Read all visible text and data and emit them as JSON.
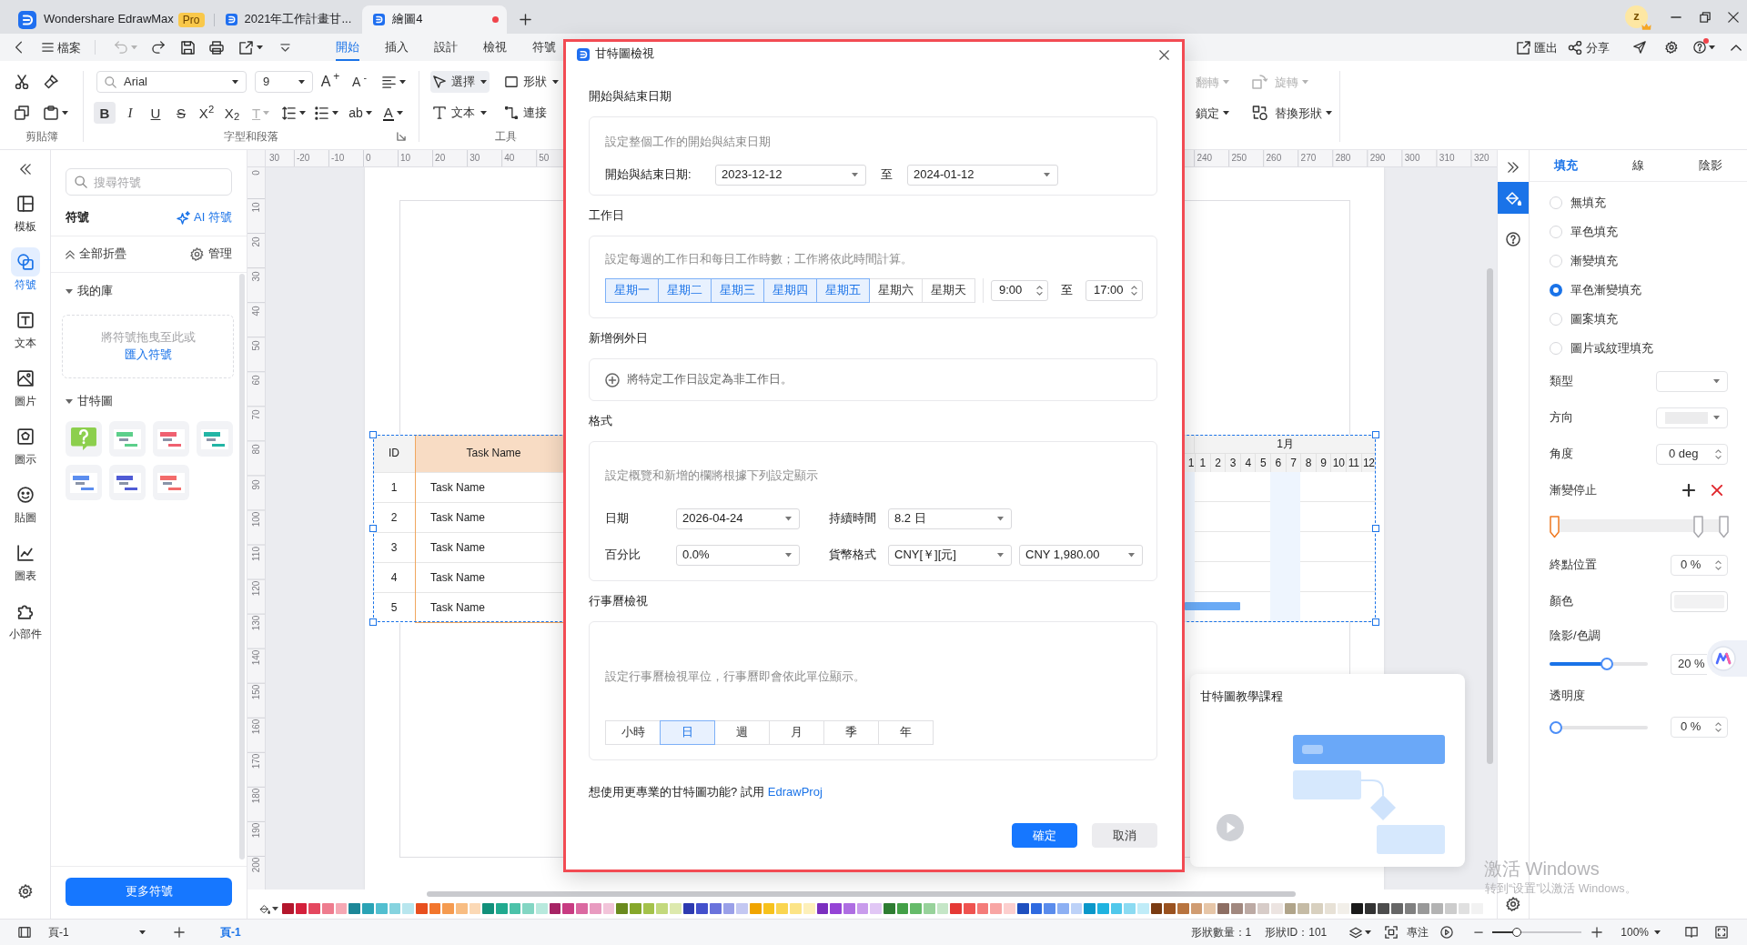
{
  "title_bar": {
    "tabs": [
      {
        "kind": "app",
        "label": "Wondershare EdrawMax",
        "badge": "Pro",
        "selected": false,
        "unsaved": false
      },
      {
        "kind": "document",
        "label": "2021年工作計畫甘...",
        "selected": false,
        "unsaved": false
      },
      {
        "kind": "document",
        "label": "繪圖4",
        "selected": true,
        "unsaved": true
      }
    ],
    "avatar": "z"
  },
  "menu_bar": {
    "file_label": "檔案",
    "undo": {
      "disabled": true
    },
    "tabs": [
      {
        "label": "開始",
        "selected": true
      },
      {
        "label": "插入",
        "selected": false
      },
      {
        "label": "設計",
        "selected": false
      },
      {
        "label": "檢視",
        "selected": false
      },
      {
        "label": "符號",
        "selected": false
      }
    ],
    "actions": [
      {
        "kind": "export",
        "label": "匯出"
      },
      {
        "kind": "share",
        "label": "分享"
      }
    ],
    "help": {
      "notification": true
    }
  },
  "ribbon": {
    "groups": [
      {
        "label": "剪貼簿",
        "launcher": false
      },
      {
        "label": "字型和段落",
        "launcher": true
      },
      {
        "label": "工具",
        "launcher": false
      }
    ],
    "font": {
      "value": "Arial"
    },
    "font_size": {
      "value": "9"
    },
    "font_buttons": [
      {
        "kind": "grow",
        "glyph": "A$^{+}$"
      },
      {
        "kind": "shrink",
        "glyph": "A$^{-}$"
      }
    ],
    "format_buttons": [
      {
        "kind": "bold",
        "glyph": "B",
        "on": true,
        "disabled": false
      },
      {
        "kind": "italic",
        "glyph": "I",
        "on": false,
        "disabled": false
      },
      {
        "kind": "underline",
        "glyph": "U",
        "on": false,
        "disabled": false
      },
      {
        "kind": "strike",
        "glyph": "S",
        "on": false,
        "disabled": false
      },
      {
        "kind": "superscript",
        "glyph": "X$^{2}$",
        "on": false,
        "disabled": false
      },
      {
        "kind": "subscript",
        "glyph": "X$_{2}$",
        "on": false,
        "disabled": false
      },
      {
        "kind": "clear",
        "glyph": "T",
        "on": false,
        "disabled": true
      },
      {
        "kind": "highlight",
        "glyph": "ab",
        "on": false,
        "disabled": false
      },
      {
        "kind": "color",
        "glyph": "A",
        "on": false,
        "disabled": false
      }
    ],
    "tools": [
      {
        "kind": "select",
        "label": "選擇",
        "selected": true
      },
      {
        "kind": "shape",
        "label": "形狀",
        "selected": false
      },
      {
        "kind": "text",
        "label": "文本",
        "selected": false
      },
      {
        "kind": "connector",
        "label": "連接",
        "selected": false
      }
    ],
    "arrange": [
      {
        "kind": "flip",
        "label": "翻轉",
        "disabled": true
      },
      {
        "kind": "rotate",
        "label": "旋轉",
        "disabled": true
      },
      {
        "kind": "lock",
        "label": "鎖定",
        "disabled": false
      },
      {
        "kind": "replace",
        "label": "替換形狀",
        "disabled": false
      }
    ]
  },
  "side_rail": {
    "items": [
      {
        "kind": "templates",
        "label": "模板",
        "selected": false
      },
      {
        "kind": "symbols",
        "label": "符號",
        "selected": true
      },
      {
        "kind": "text",
        "label": "文本",
        "selected": false
      },
      {
        "kind": "images",
        "label": "圖片",
        "selected": false
      },
      {
        "kind": "icons",
        "label": "圖示",
        "selected": false
      },
      {
        "kind": "stickers",
        "label": "貼圖",
        "selected": false
      },
      {
        "kind": "charts",
        "label": "圖表",
        "selected": false
      },
      {
        "kind": "widgets",
        "label": "小部件",
        "selected": false
      }
    ]
  },
  "library": {
    "search": {
      "placeholder": "搜尋符號"
    },
    "title": "符號",
    "ai_link": "AI 符號",
    "collapse_all": "全部折疊",
    "manage": "管理",
    "my_library": {
      "label": "我的庫",
      "expanded": true,
      "drop_hint": "將符號拖曳至此或",
      "import_link": "匯入符號"
    },
    "gantt": {
      "label": "甘特圖",
      "expanded": true,
      "thumbnails": [
        {
          "kind": "help"
        },
        {
          "kind": "gantt",
          "color": "#5ccf8a"
        },
        {
          "kind": "gantt",
          "color": "#f06070"
        },
        {
          "kind": "gantt",
          "color": "#22b5a5"
        },
        {
          "kind": "gantt",
          "color": "#5b8def"
        },
        {
          "kind": "gantt",
          "color": "#4f5bd5"
        },
        {
          "kind": "gantt",
          "color": "#f36b6b"
        }
      ]
    },
    "more_button": "更多符號"
  },
  "canvas": {
    "top_ruler": {
      "left_labels": [
        "30",
        "-20",
        "-10",
        "0",
        "10",
        "20",
        "30",
        "40",
        "50"
      ],
      "right_labels": [
        "240",
        "250",
        "260",
        "270",
        "280",
        "290",
        "300",
        "310",
        "320"
      ]
    },
    "left_ruler": [
      "0",
      "10",
      "20",
      "30",
      "40",
      "50",
      "60",
      "70",
      "80",
      "90",
      "100",
      "110",
      "120",
      "130",
      "140",
      "150",
      "160",
      "170",
      "180",
      "190",
      "200"
    ],
    "gantt": {
      "selected": true,
      "columns": [
        "ID",
        "Task Name"
      ],
      "rows": [
        {
          "id": "1",
          "task": "Task Name",
          "bar": false
        },
        {
          "id": "2",
          "task": "Task Name",
          "bar": false
        },
        {
          "id": "3",
          "task": "Task Name",
          "bar": false
        },
        {
          "id": "4",
          "task": "Task Name",
          "bar": false
        },
        {
          "id": "5",
          "task": "Task Name",
          "bar": true
        }
      ],
      "month": "1月",
      "days": [
        {
          "label": "1",
          "weekend": true
        },
        {
          "label": "1",
          "weekend": false
        },
        {
          "label": "2",
          "weekend": false
        },
        {
          "label": "3",
          "weekend": false
        },
        {
          "label": "4",
          "weekend": false
        },
        {
          "label": "5",
          "weekend": false
        },
        {
          "label": "6",
          "weekend": true
        },
        {
          "label": "7",
          "weekend": true
        },
        {
          "label": "8",
          "weekend": false
        },
        {
          "label": "9",
          "weekend": false
        },
        {
          "label": "10",
          "weekend": false
        },
        {
          "label": "11",
          "weekend": false
        },
        {
          "label": "12",
          "weekend": false
        }
      ]
    }
  },
  "dialog": {
    "highlighted": true,
    "title": "甘特圖檢視",
    "date_range": {
      "heading": "開始與結束日期",
      "hint": "設定整個工作的開始與結束日期",
      "label": "開始與結束日期:",
      "start": "2023-12-12",
      "separator": "至",
      "end": "2024-01-12"
    },
    "workdays": {
      "heading": "工作日",
      "hint": "設定每週的工作日和每日工作時數；工作將依此時間計算。",
      "days": [
        {
          "label": "星期一",
          "selected": true
        },
        {
          "label": "星期二",
          "selected": true
        },
        {
          "label": "星期三",
          "selected": true
        },
        {
          "label": "星期四",
          "selected": true
        },
        {
          "label": "星期五",
          "selected": true
        },
        {
          "label": "星期六",
          "selected": false
        },
        {
          "label": "星期天",
          "selected": false
        }
      ],
      "start_time": "9:00",
      "separator": "至",
      "end_time": "17:00"
    },
    "exceptions": {
      "heading": "新增例外日",
      "action": "將特定工作日設定為非工作日。"
    },
    "format": {
      "heading": "格式",
      "hint": "設定概覽和新增的欄將根據下列設定顯示",
      "fields": [
        {
          "label": "日期",
          "values": [
            "2026-04-24"
          ]
        },
        {
          "label": "持續時間",
          "values": [
            "8.2 日"
          ]
        },
        {
          "label": "百分比",
          "values": [
            "0.0%"
          ]
        },
        {
          "label": "貨幣格式",
          "values": [
            "CNY[￥][元]",
            "CNY 1,980.00"
          ]
        }
      ]
    },
    "calendar_view": {
      "heading": "行事曆檢視",
      "hint": "設定行事曆檢視單位，行事曆即會依此單位顯示。",
      "units": [
        {
          "label": "小時",
          "selected": false
        },
        {
          "label": "日",
          "selected": true
        },
        {
          "label": "週",
          "selected": false
        },
        {
          "label": "月",
          "selected": false
        },
        {
          "label": "季",
          "selected": false
        },
        {
          "label": "年",
          "selected": false
        }
      ]
    },
    "footer_text": "想使用更專業的甘特圖功能? 試用",
    "footer_link": "EdrawProj",
    "buttons": [
      {
        "kind": "primary",
        "label": "確定"
      },
      {
        "kind": "secondary",
        "label": "取消"
      }
    ]
  },
  "tutorial": {
    "title": "甘特圖教學課程"
  },
  "right_panel": {
    "strip_tabs": [
      {
        "kind": "fill",
        "selected": true
      }
    ],
    "tabs": [
      {
        "label": "填充",
        "selected": true
      },
      {
        "label": "線",
        "selected": false
      },
      {
        "label": "陰影",
        "selected": false
      }
    ],
    "fill_options": [
      {
        "label": "無填充",
        "selected": false
      },
      {
        "label": "單色填充",
        "selected": false
      },
      {
        "label": "漸變填充",
        "selected": false
      },
      {
        "label": "單色漸變填充",
        "selected": true
      },
      {
        "label": "圖案填充",
        "selected": false
      },
      {
        "label": "圖片或紋理填充",
        "selected": false
      }
    ],
    "type": {
      "label": "類型"
    },
    "direction": {
      "label": "方向"
    },
    "angle": {
      "label": "角度",
      "value": "0 deg"
    },
    "gradient_stops": {
      "label": "漸變停止",
      "stops": [
        {
          "selected": true
        },
        {
          "selected": false
        },
        {
          "selected": false
        }
      ]
    },
    "end_position": {
      "label": "終點位置",
      "value": "0 %"
    },
    "color": {
      "label": "顏色"
    },
    "shade": {
      "label": "陰影/色調",
      "level": 0.6,
      "value": "20 %"
    },
    "transparency": {
      "label": "透明度",
      "level": 0,
      "value": "0 %"
    }
  },
  "palette": [
    {
      "color": "#b3162c"
    },
    {
      "color": "#d4203b"
    },
    {
      "color": "#e4485f"
    },
    {
      "color": "#ee7c8e"
    },
    {
      "color": "#f5a8b4"
    },
    {
      "color": "#1d8798"
    },
    {
      "color": "#2aa3b5"
    },
    {
      "color": "#52bfd0"
    },
    {
      "color": "#86d3df"
    },
    {
      "color": "#b8e6ee"
    },
    {
      "color": "#e84f1e"
    },
    {
      "color": "#f2762d"
    },
    {
      "color": "#f59b50"
    },
    {
      "color": "#f8bd83"
    },
    {
      "color": "#fbd9b6"
    },
    {
      "color": "#12907a"
    },
    {
      "color": "#21aa8f"
    },
    {
      "color": "#4cc2a9"
    },
    {
      "color": "#83d6c3"
    },
    {
      "color": "#b8e9dd"
    },
    {
      "color": "#a62465"
    },
    {
      "color": "#c83b82"
    },
    {
      "color": "#db69a1"
    },
    {
      "color": "#e89bc0"
    },
    {
      "color": "#f2c5da"
    },
    {
      "color": "#6a8a1e"
    },
    {
      "color": "#86a72b"
    },
    {
      "color": "#a4c24b"
    },
    {
      "color": "#c3d97d"
    },
    {
      "color": "#dde9ae"
    },
    {
      "color": "#2d3ab0"
    },
    {
      "color": "#4350cc"
    },
    {
      "color": "#6a73dc"
    },
    {
      "color": "#9aa0e8"
    },
    {
      "color": "#c4c8f2"
    },
    {
      "color": "#f0a400"
    },
    {
      "color": "#f7c21d"
    },
    {
      "color": "#fad550"
    },
    {
      "color": "#fce487"
    },
    {
      "color": "#fdf0ba"
    },
    {
      "color": "#7b2fbf"
    },
    {
      "color": "#9544d6"
    },
    {
      "color": "#ae6ee2"
    },
    {
      "color": "#c99cec"
    },
    {
      "color": "#e1c7f5"
    },
    {
      "color": "#2e7d32"
    },
    {
      "color": "#43a047"
    },
    {
      "color": "#66bb6a"
    },
    {
      "color": "#98d29b"
    },
    {
      "color": "#c5e6c7"
    },
    {
      "color": "#e53935"
    },
    {
      "color": "#ef5350"
    },
    {
      "color": "#f47c7a"
    },
    {
      "color": "#f8a6a4"
    },
    {
      "color": "#fccfce"
    },
    {
      "color": "#1e4fbf"
    },
    {
      "color": "#2f6ae0"
    },
    {
      "color": "#5a8cec"
    },
    {
      "color": "#8db0f3"
    },
    {
      "color": "#bdd2f8"
    },
    {
      "color": "#0a97c9"
    },
    {
      "color": "#1fb3e0"
    },
    {
      "color": "#51c8eb"
    },
    {
      "color": "#8cdbf2"
    },
    {
      "color": "#c0ecf8"
    },
    {
      "color": "#7a3b12"
    },
    {
      "color": "#9a5220"
    },
    {
      "color": "#b8743f"
    },
    {
      "color": "#d09c72"
    },
    {
      "color": "#e6c6a8"
    },
    {
      "color": "#8d6e63"
    },
    {
      "color": "#a1887f"
    },
    {
      "color": "#bcaaa4"
    },
    {
      "color": "#d7ccc8"
    },
    {
      "color": "#ece4e1"
    },
    {
      "color": "#b0a48a"
    },
    {
      "color": "#c5bba5"
    },
    {
      "color": "#d8d0bf"
    },
    {
      "color": "#e7e1d6"
    },
    {
      "color": "#f2efe9"
    },
    {
      "color": "#1a1a1a"
    },
    {
      "color": "#333333"
    },
    {
      "color": "#4d4d4d"
    },
    {
      "color": "#666666"
    },
    {
      "color": "#808080"
    },
    {
      "color": "#999999"
    },
    {
      "color": "#b3b3b3"
    },
    {
      "color": "#cccccc"
    },
    {
      "color": "#e0e0e0"
    },
    {
      "color": "#f2f2f2"
    }
  ],
  "status_bar": {
    "page_select": "頁-1",
    "pages": [
      {
        "label": "頁-1",
        "selected": true
      }
    ],
    "shape_count": "形狀數量：1",
    "shape_id": "形狀ID：101",
    "focus": "專注",
    "zoom": {
      "level": 0.25,
      "value": "100%"
    }
  },
  "activation_notice": {
    "title": "激活 Windows",
    "hint": "转到“设置”以激活 Windows。"
  }
}
